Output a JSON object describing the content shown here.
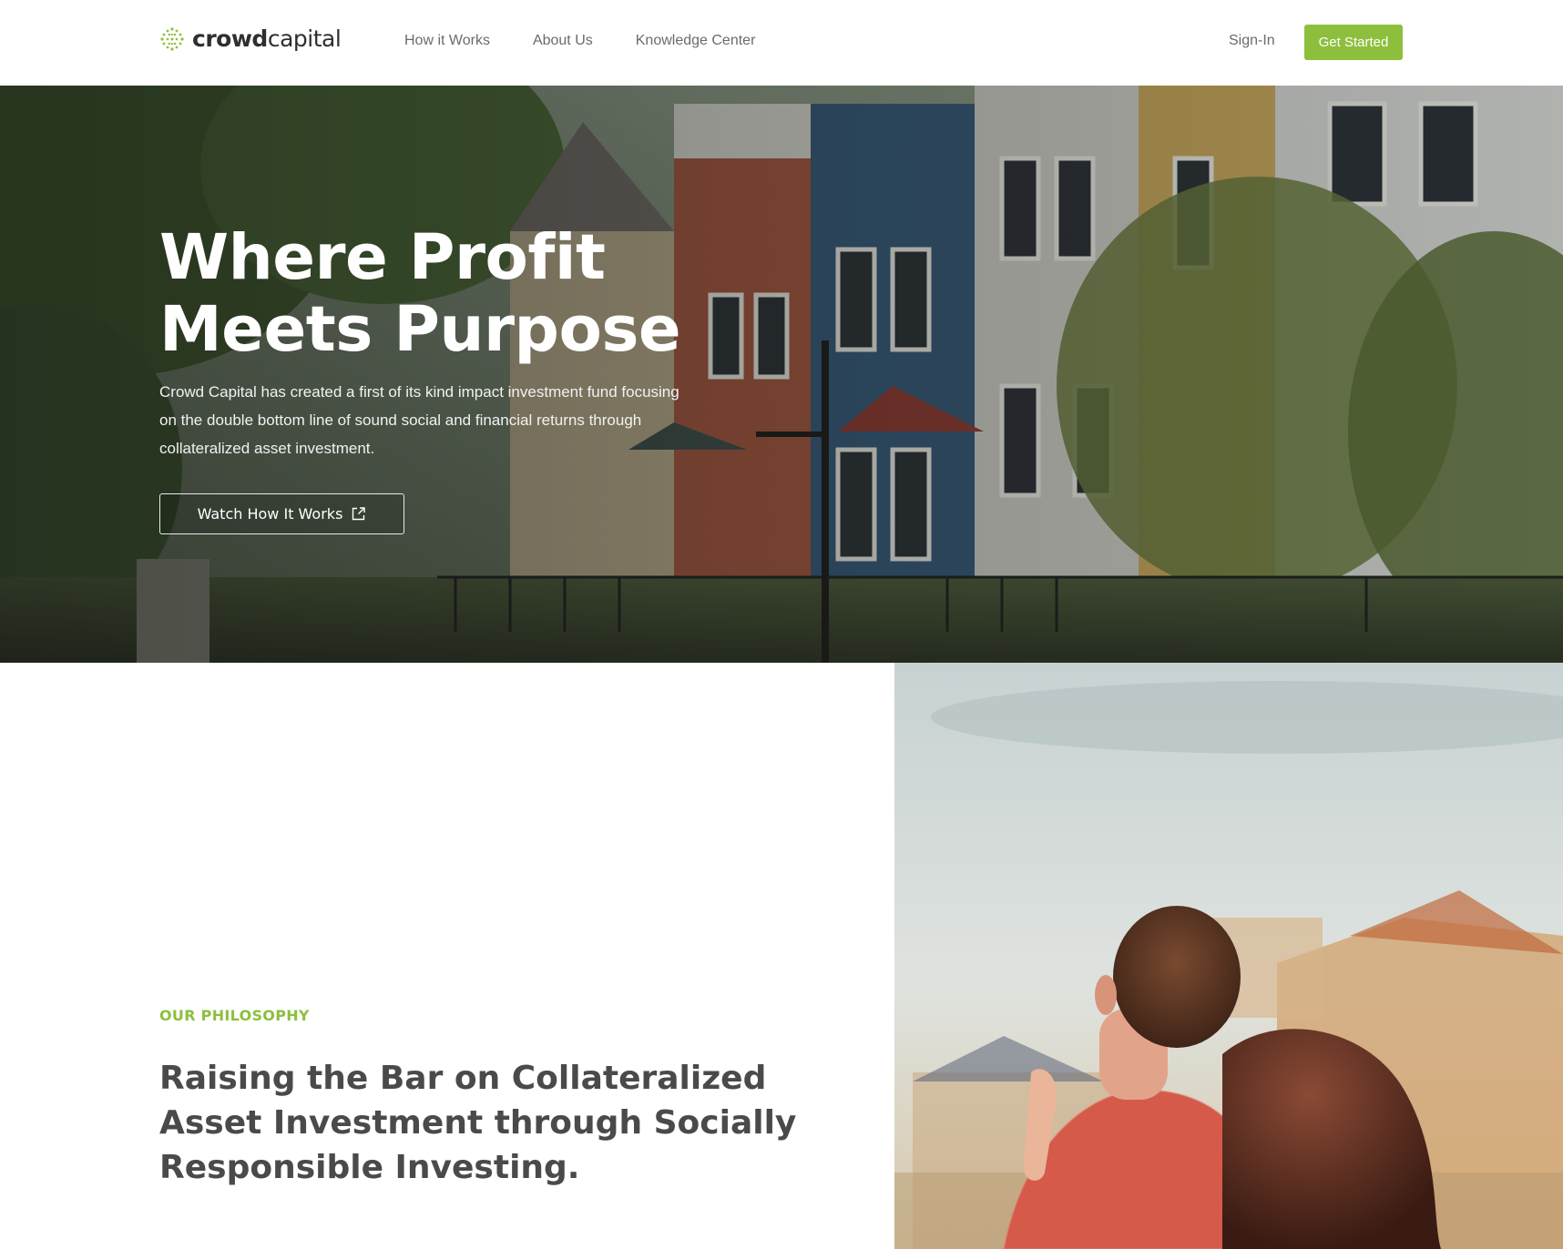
{
  "header": {
    "logo": {
      "text_bold": "crowd",
      "text_light": "capital",
      "icon": "crowdcapital-logo-mark"
    },
    "nav": [
      {
        "label": "How it Works"
      },
      {
        "label": "About Us"
      },
      {
        "label": "Knowledge Center"
      }
    ],
    "signin_label": "Sign-In",
    "cta_label": "Get Started"
  },
  "hero": {
    "title_line1": "Where Profit",
    "title_line2": "Meets Purpose",
    "description": "Crowd Capital has created a first of its kind impact investment fund focusing on the double bottom line of sound social and financial returns through collateralized asset investment.",
    "watch_button_label": "Watch How It Works",
    "watch_button_icon": "external-link-icon"
  },
  "philosophy": {
    "eyebrow": "OUR PHILOSOPHY",
    "title": "Raising the Bar on Collateralized Asset Investment through Socially Responsible Investing."
  },
  "colors": {
    "accent": "#8dbf3d",
    "heading": "#4a4a4a",
    "nav_text": "#6b6b6b"
  }
}
